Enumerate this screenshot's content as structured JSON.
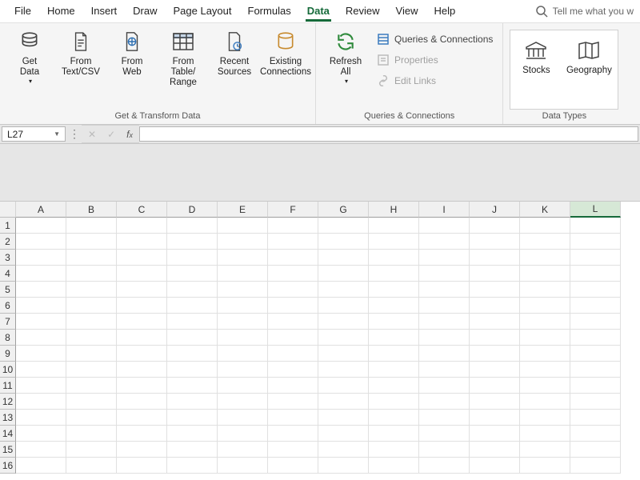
{
  "tabs": {
    "items": [
      "File",
      "Home",
      "Insert",
      "Draw",
      "Page Layout",
      "Formulas",
      "Data",
      "Review",
      "View",
      "Help"
    ],
    "active_index": 6
  },
  "tellme": {
    "placeholder": "Tell me what you w"
  },
  "ribbon": {
    "group1": {
      "label": "Get & Transform Data",
      "get_data": "Get\nData",
      "from_textcsv": "From\nText/CSV",
      "from_web": "From\nWeb",
      "from_table": "From Table/\nRange",
      "recent_sources": "Recent\nSources",
      "existing_conn": "Existing\nConnections"
    },
    "group2": {
      "label": "Queries & Connections",
      "refresh_all": "Refresh\nAll",
      "queries": "Queries & Connections",
      "properties": "Properties",
      "edit_links": "Edit Links"
    },
    "group3": {
      "label": "Data Types",
      "stocks": "Stocks",
      "geography": "Geography"
    }
  },
  "namebox": {
    "value": "L27"
  },
  "grid": {
    "cols": [
      "A",
      "B",
      "C",
      "D",
      "E",
      "F",
      "G",
      "H",
      "I",
      "J",
      "K",
      "L"
    ],
    "selected_col": "L",
    "rows": 16
  }
}
